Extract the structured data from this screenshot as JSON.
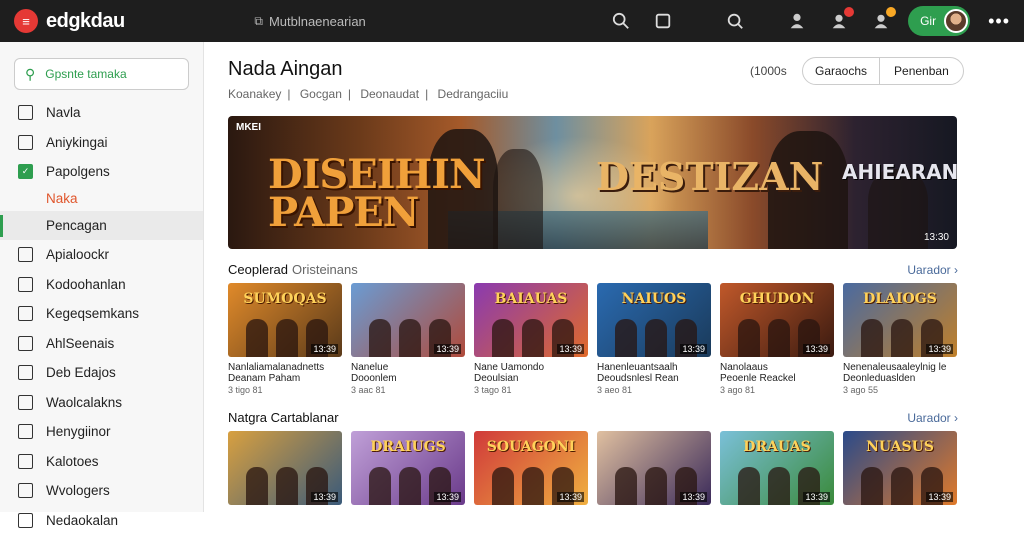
{
  "app": {
    "name": "edgkdau",
    "logo_glyph": "≡"
  },
  "topbar": {
    "search_text": "Mutblnaenearian",
    "icons": [
      "search-icon",
      "square-icon",
      "search-icon",
      "person-icon",
      "notification-icon"
    ],
    "user_label": "Gir",
    "more": "•••"
  },
  "sidebar": {
    "search_placeholder": "Gpsnte tamaka",
    "items": [
      {
        "label": "Navla",
        "icon": "chart-icon"
      },
      {
        "label": "Aniykingai",
        "icon": "user-icon"
      },
      {
        "label": "Papolgens",
        "icon": "check-icon",
        "checked": true
      },
      {
        "label": "Naka",
        "sub": true
      },
      {
        "label": "Pencagan",
        "active": true
      },
      {
        "label": "Apialoockr",
        "icon": "box-icon"
      },
      {
        "label": "Kodoohanlan",
        "icon": "box-icon"
      },
      {
        "label": "Kegeqsemkans",
        "icon": "box-icon"
      },
      {
        "label": "AhlSeenais",
        "icon": "box-icon"
      },
      {
        "label": "Deb Edajos",
        "icon": "box-icon"
      },
      {
        "label": "Waolcalakns",
        "icon": "box-icon"
      },
      {
        "label": "Henygiinor",
        "icon": "box-icon"
      },
      {
        "label": "Kalotoes",
        "icon": "box-icon"
      },
      {
        "label": "Wvologers",
        "icon": "box-icon"
      },
      {
        "label": "Nedaokalan",
        "icon": "box-icon"
      }
    ]
  },
  "main": {
    "title": "Nada Aingan",
    "breadcrumb": [
      "Koanakey",
      "Gocgan",
      "Deonaudat",
      "Dedrangaciiu"
    ],
    "count": "1000s",
    "segments": [
      "Garaochs",
      "Penenban"
    ],
    "hero": {
      "tag": "MKEI",
      "title_left": "DISEIHIN PAPEN",
      "title_center": "DESTIZAN",
      "title_right": "AHIEARAN",
      "duration": "13:30"
    },
    "section1": {
      "title": "Ceoplerad",
      "subtitle": "Oristeinans",
      "link": "Uarador ›",
      "cards": [
        {
          "title": "SUMOQAS",
          "line1": "Nanlaliamalanadnetts",
          "line2": "Deanam Paham",
          "stats": "3 tigo 81",
          "duration": "13:39",
          "c1": "#e08a2a",
          "c2": "#5a3a1a"
        },
        {
          "title": "",
          "line1": "Nanelue",
          "line2": "Dooonlem",
          "stats": "3 aac 81",
          "duration": "13:39",
          "c1": "#6a9cd4",
          "c2": "#b04a3a"
        },
        {
          "title": "BAIAUAS",
          "line1": "Nane Uamondo",
          "line2": "Deoulsian",
          "stats": "3 tago 81",
          "duration": "13:39",
          "c1": "#8a3ab0",
          "c2": "#e06a2a"
        },
        {
          "title": "NAIUOS",
          "line1": "Hanenleuantsaalh",
          "line2": "Deoudsnlesl Rean",
          "stats": "3 aeo 81",
          "duration": "13:39",
          "c1": "#2a6ab0",
          "c2": "#1a3a5a"
        },
        {
          "title": "GHUDON",
          "line1": "Nanolaaus",
          "line2": "Peoenle Reackel",
          "stats": "3 ago 81",
          "duration": "13:39",
          "c1": "#c0582a",
          "c2": "#3a1a10"
        },
        {
          "title": "DLAIOGS",
          "line1": "Nenenaleusaaleylnig le",
          "line2": "Deonleduaslden",
          "stats": "3 ago 55",
          "duration": "13:39",
          "c1": "#4a6aa0",
          "c2": "#c0802a"
        }
      ]
    },
    "section2": {
      "title": "Natgra Cartablanar",
      "link": "Uarador ›",
      "cards": [
        {
          "title": "",
          "duration": "13:39",
          "c1": "#d8a040",
          "c2": "#3a5a7a"
        },
        {
          "title": "DRAIUGS",
          "duration": "13:39",
          "c1": "#c0a0d8",
          "c2": "#6a3a8a"
        },
        {
          "title": "SOUAGONI",
          "duration": "13:39",
          "c1": "#d03a3a",
          "c2": "#f0b040"
        },
        {
          "title": "",
          "duration": "13:39",
          "c1": "#e0c0a0",
          "c2": "#3a2a5a"
        },
        {
          "title": "DRAUAS",
          "duration": "13:39",
          "c1": "#7ac0d8",
          "c2": "#3a8a3a"
        },
        {
          "title": "NUASUS",
          "duration": "13:39",
          "c1": "#2a4a8a",
          "c2": "#e07a2a"
        }
      ]
    }
  },
  "colors": {
    "accent": "#2e9e4f",
    "topbar": "#1e1e1e",
    "alert": "#e53935",
    "link": "#4a6a9a"
  }
}
